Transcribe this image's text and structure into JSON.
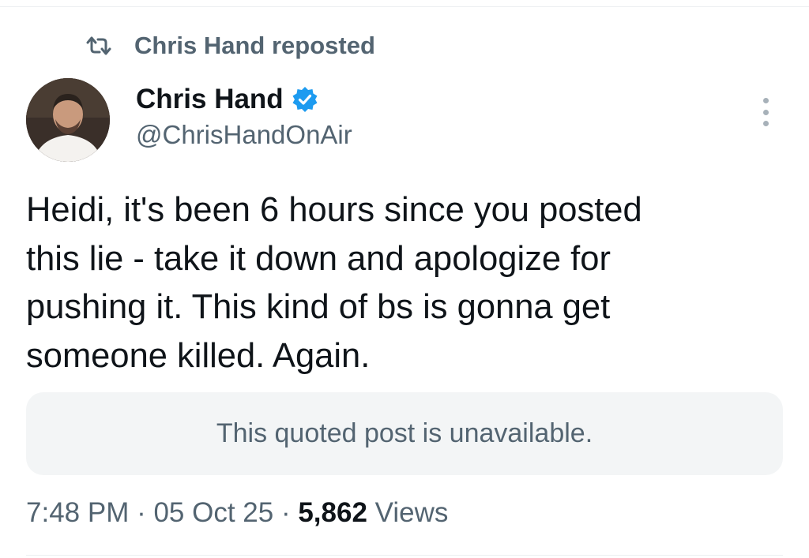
{
  "repost": {
    "label": "Chris Hand reposted",
    "icon": "repost-icon"
  },
  "author": {
    "display_name": "Chris Hand",
    "handle": "@ChrisHandOnAir",
    "verified": true,
    "verified_color": "#1d9bf0"
  },
  "post": {
    "text": "Heidi, it's been 6 hours since you posted\nthis lie - take it down and apologize for\npushing it. This kind of bs is gonna get\nsomeone killed. Again."
  },
  "quote": {
    "text": "This quoted post is unavailable."
  },
  "meta": {
    "time": "7:48 PM",
    "separator": " · ",
    "date": "05 Oct 25",
    "views_count": "5,862",
    "views_label": "Views"
  },
  "colors": {
    "primary_text": "#0f1419",
    "secondary_text": "#536471",
    "quote_bg": "#f3f5f6"
  }
}
